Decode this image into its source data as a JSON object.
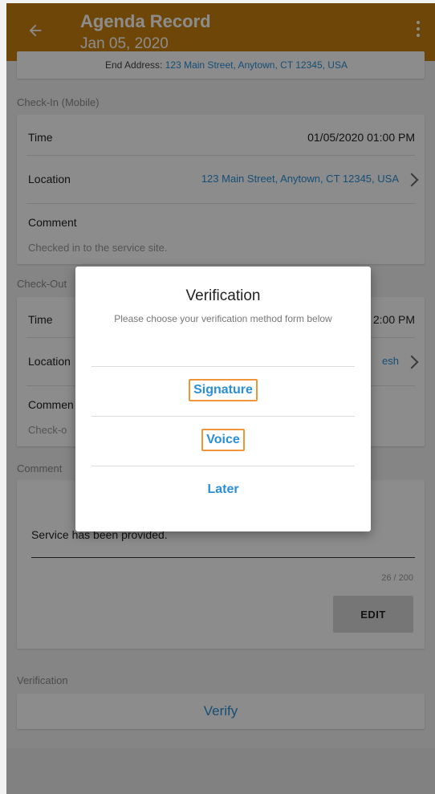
{
  "appbar": {
    "title": "Agenda Record",
    "subtitle": "Jan 05, 2020",
    "back_icon": "arrow-left-icon",
    "menu_icon": "more-vert-icon",
    "color": "#c9820f"
  },
  "end_address": {
    "label": "End Address:",
    "value": "123 Main Street, Anytown, CT 12345, USA"
  },
  "check_in": {
    "section": "Check-In (Mobile)",
    "time_label": "Time",
    "time_value": "01/05/2020 01:00 PM",
    "location_label": "Location",
    "location_value": "123 Main Street, Anytown, CT 12345, USA",
    "comment_label": "Comment",
    "comment_value": "Checked in to the service site."
  },
  "check_out": {
    "section": "Check-Out",
    "time_label": "Time",
    "time_value_partial": "2:00 PM",
    "location_label": "Location",
    "location_value_partial": "esh",
    "comment_label": "Commen",
    "comment_value_partial": "Check-o"
  },
  "comment_section": {
    "section": "Comment",
    "text": "Service has been provided.",
    "counter": "26 / 200",
    "edit_label": "EDIT"
  },
  "verification_section": {
    "section": "Verification",
    "verify_label": "Verify"
  },
  "dialog": {
    "title": "Verification",
    "message": "Please choose your verification method form below",
    "options": [
      "Signature",
      "Voice",
      "Later"
    ]
  },
  "colors": {
    "link": "#2a8fd6",
    "highlight_box": "#f0963a"
  }
}
